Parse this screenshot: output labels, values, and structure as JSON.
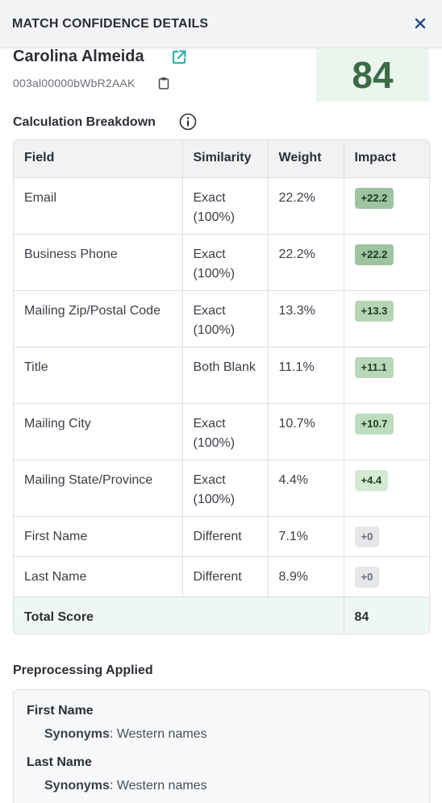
{
  "header": {
    "title": "MATCH CONFIDENCE DETAILS",
    "close_icon": "close-icon"
  },
  "record": {
    "name": "Carolina Almeida",
    "id": "003al00000bWbR2AAK"
  },
  "score": {
    "value": "84"
  },
  "breakdown": {
    "title": "Calculation Breakdown",
    "columns": [
      "Field",
      "Similarity",
      "Weight",
      "Impact"
    ],
    "rows": [
      {
        "field": "Email",
        "similarity": "Exact (100%)",
        "weight": "22.2%",
        "impact": "+22.2",
        "impact_color": "#9cc59f"
      },
      {
        "field": "Business Phone",
        "similarity": "Exact (100%)",
        "weight": "22.2%",
        "impact": "+22.2",
        "impact_color": "#9cc59f"
      },
      {
        "field": "Mailing Zip/Postal Code",
        "similarity": "Exact (100%)",
        "weight": "13.3%",
        "impact": "+13.3",
        "impact_color": "#b4d6b4"
      },
      {
        "field": "Title",
        "similarity": "Both Blank",
        "weight": "11.1%",
        "impact": "+11.1",
        "impact_color": "#b8d9b9"
      },
      {
        "field": "Mailing City",
        "similarity": "Exact (100%)",
        "weight": "10.7%",
        "impact": "+10.7",
        "impact_color": "#bcdcbd"
      },
      {
        "field": "Mailing State/Province",
        "similarity": "Exact (100%)",
        "weight": "4.4%",
        "impact": "+4.4",
        "impact_color": "#d5ead5"
      },
      {
        "field": "First Name",
        "similarity": "Different",
        "weight": "7.1%",
        "impact": "+0",
        "impact_color": "#e6e7e9"
      },
      {
        "field": "Last Name",
        "similarity": "Different",
        "weight": "8.9%",
        "impact": "+0",
        "impact_color": "#e6e7e9"
      }
    ],
    "total": {
      "label": "Total Score",
      "value": "84"
    }
  },
  "preprocessing": {
    "title": "Preprocessing Applied",
    "items": [
      {
        "field": "First Name",
        "rule_label": "Synonyms",
        "rule_value": ": Western names"
      },
      {
        "field": "Last Name",
        "rule_label": "Synonyms",
        "rule_value": ": Western names"
      }
    ]
  },
  "colors": {
    "accent": "#2bb3a3",
    "score_text": "#3b6b45",
    "score_bg": "#eaf5ee"
  }
}
